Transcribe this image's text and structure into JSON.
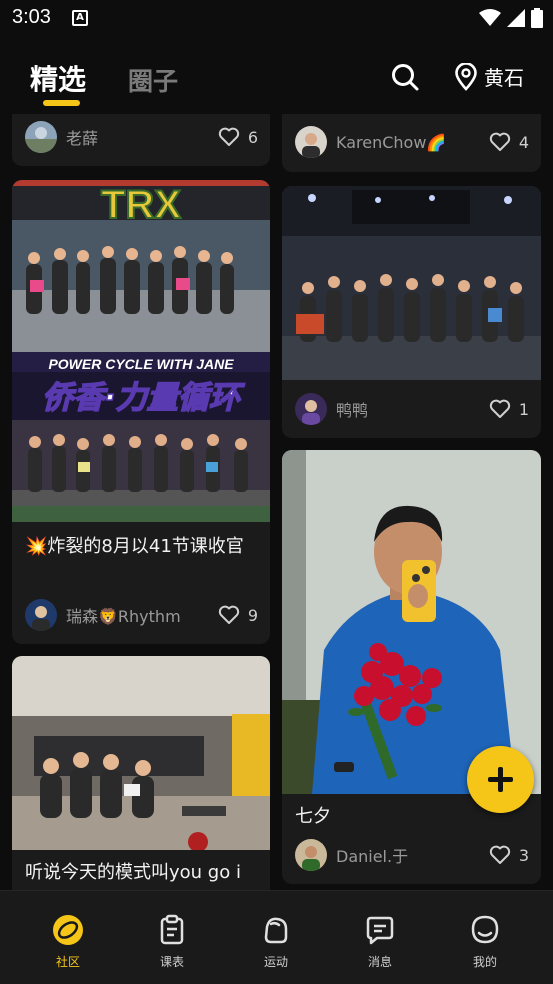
{
  "status_bar": {
    "time": "3:03",
    "notification_glyph": "A",
    "icons": [
      "wifi-icon",
      "signal-icon",
      "battery-icon"
    ]
  },
  "header": {
    "tabs": [
      {
        "label": "精选",
        "active": true
      },
      {
        "label": "圈子",
        "active": false
      }
    ],
    "location": "黄石",
    "accent_color": "#f5c518"
  },
  "feed": {
    "left": [
      {
        "user": "老薛",
        "likes": "6"
      },
      {
        "title": "💥炸裂的8月以41节课收官",
        "image_texts": [
          "TRX",
          "POWER CYCLE WITH JANE",
          "侨香·力量循环"
        ],
        "user": "瑞森🦁Rhythm",
        "likes": "9"
      },
      {
        "title": "听说今天的模式叫you go i"
      }
    ],
    "right": [
      {
        "user": "KarenChow🌈",
        "likes": "4"
      },
      {
        "user": "鸭鸭",
        "likes": "1"
      },
      {
        "title": "七夕",
        "user": "Daniel.于",
        "likes": "3"
      }
    ]
  },
  "fab": {
    "icon": "plus-icon"
  },
  "bottom_nav": [
    {
      "label": "社区",
      "icon": "community-icon",
      "active": true
    },
    {
      "label": "课表",
      "icon": "schedule-icon",
      "active": false
    },
    {
      "label": "运动",
      "icon": "workout-icon",
      "active": false
    },
    {
      "label": "消息",
      "icon": "message-icon",
      "active": false
    },
    {
      "label": "我的",
      "icon": "profile-icon",
      "active": false
    }
  ]
}
